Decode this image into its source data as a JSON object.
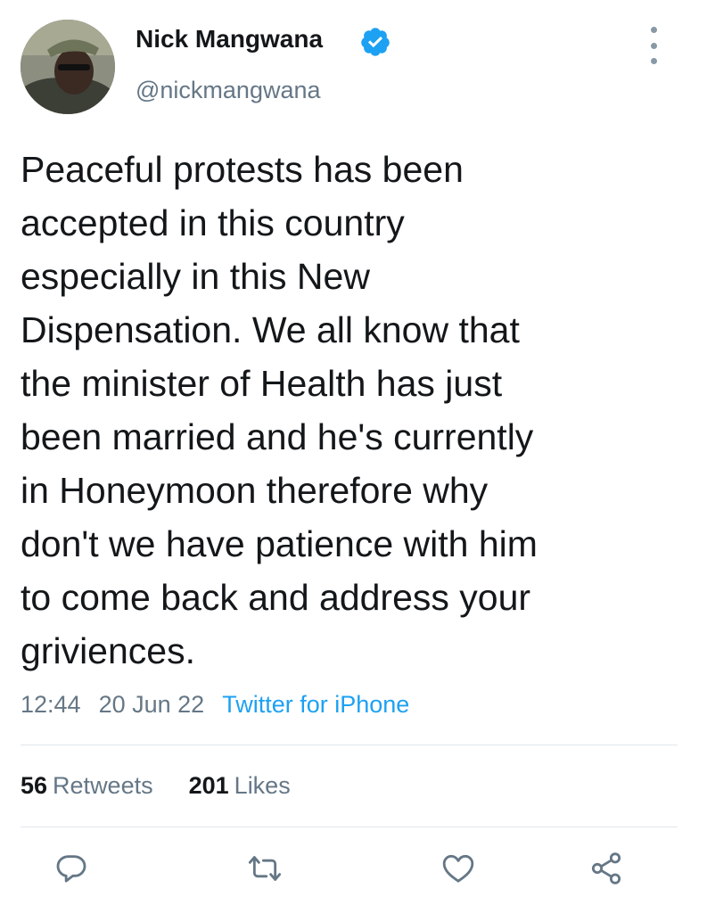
{
  "header": {
    "display_name": "Nick Mangwana",
    "handle": "@nickmangwana",
    "verified_icon": "verified-badge-icon",
    "more_icon": "more-options-icon"
  },
  "tweet": {
    "text_lines": [
      "Peaceful protests has been",
      "accepted in this country",
      "especially in this New",
      "Dispensation. We all know that",
      "the minister of Health has just",
      "been married and he's currently",
      "in Honeymoon therefore why",
      "don't we have patience with him",
      "to come back and address your",
      "griviences."
    ],
    "time": "12:44",
    "date": "20 Jun 22",
    "source": "Twitter for iPhone"
  },
  "stats": {
    "retweets_count": "56",
    "retweets_label": "Retweets",
    "likes_count": "201",
    "likes_label": "Likes"
  },
  "actions": {
    "reply_icon": "reply-icon",
    "retweet_icon": "retweet-icon",
    "like_icon": "heart-icon",
    "share_icon": "share-icon"
  },
  "colors": {
    "text": "#14171a",
    "secondary": "#657786",
    "accent": "#1da1f2",
    "divider": "#e1e8ed"
  }
}
